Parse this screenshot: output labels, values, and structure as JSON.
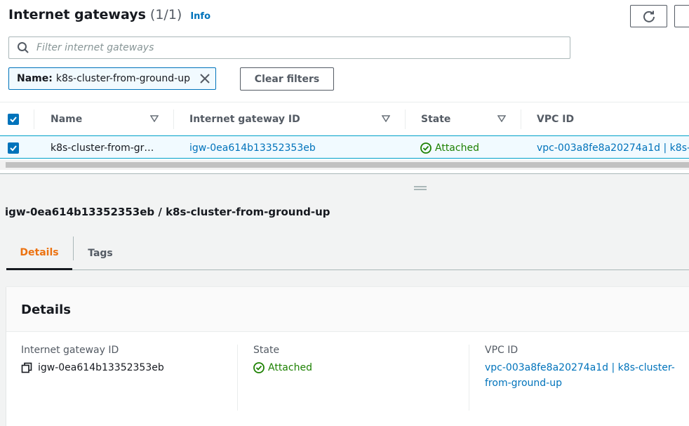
{
  "header": {
    "title": "Internet gateways",
    "count": "(1/1)",
    "info_label": "Info"
  },
  "search": {
    "placeholder": "Filter internet gateways",
    "value": ""
  },
  "filter_token": {
    "key": "Name:",
    "value": "k8s-cluster-from-ground-up"
  },
  "clear_filters_label": "Clear filters",
  "table": {
    "columns": [
      "Name",
      "Internet gateway ID",
      "State",
      "VPC ID"
    ],
    "rows": [
      {
        "selected": true,
        "name": "k8s-cluster-from-gr…",
        "gateway_id": "igw-0ea614b13352353eb",
        "state": "Attached",
        "vpc_id": "vpc-003a8fe8a20274a1d | k8s-"
      }
    ]
  },
  "detail": {
    "heading": "igw-0ea614b13352353eb / k8s-cluster-from-ground-up",
    "tabs": [
      {
        "label": "Details",
        "active": true
      },
      {
        "label": "Tags",
        "active": false
      }
    ],
    "card_title": "Details",
    "fields": {
      "gateway_id_label": "Internet gateway ID",
      "gateway_id_value": "igw-0ea614b13352353eb",
      "state_label": "State",
      "state_value": "Attached",
      "vpc_label": "VPC ID",
      "vpc_value": "vpc-003a8fe8a20274a1d | k8s-cluster-from-ground-up"
    }
  },
  "colors": {
    "link": "#0073bb",
    "success": "#1d8102",
    "active_tab": "#ec7211",
    "selected_row_bg": "#f1faff"
  },
  "icons": [
    "refresh-icon",
    "search-icon",
    "close-icon",
    "sort-down-icon",
    "checkbox-checked-icon",
    "status-ok-icon",
    "copy-icon",
    "drag-handle-icon"
  ]
}
